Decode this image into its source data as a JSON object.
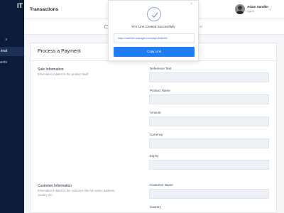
{
  "sidebar": {
    "logo": "IT",
    "items": [
      {
        "label": "s"
      },
      {
        "label": "imal",
        "active": true
      },
      {
        "label": "nents"
      }
    ]
  },
  "header": {
    "title": "Transactions",
    "user_name": "Adam Sandler",
    "user_role": "Agent"
  },
  "subbar": {
    "right_text": "nt"
  },
  "card": {
    "title": "Process a Payment",
    "sections": [
      {
        "title": "Sale Information",
        "description": "Information related to the product itself."
      },
      {
        "title": "Customer Information",
        "description": "Information related to the customer like his name, address, country etc."
      }
    ],
    "fields": [
      {
        "label": "Reference Text"
      },
      {
        "label": "Product Name"
      },
      {
        "label": "Amount"
      },
      {
        "label": "Currency"
      },
      {
        "label": "Expiry"
      },
      {
        "label": "Customer Name"
      },
      {
        "label": "Country"
      }
    ]
  },
  "modal": {
    "message": "PAY Link Created Successfully",
    "link": "https://mail-link-manager.com/pay/c1b8e4fb",
    "copy_label": "Copy Link"
  },
  "colors": {
    "sidebar_bg": "#0c1b3a",
    "accent": "#1f7cf2",
    "input_bg": "#eef2f7"
  },
  "icons": [
    "check-circle-icon",
    "close-icon",
    "chevron-down-icon",
    "card-icon"
  ]
}
